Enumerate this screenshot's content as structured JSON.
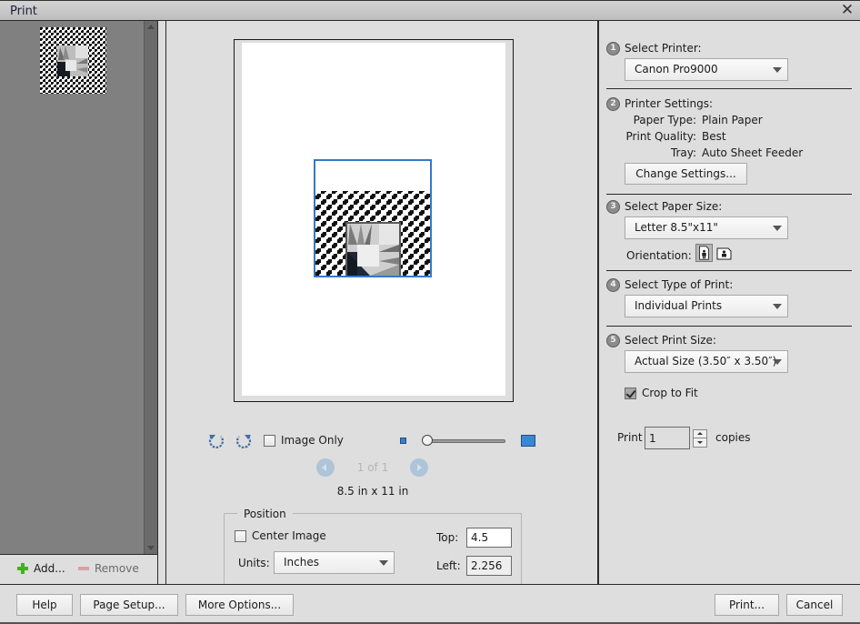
{
  "window": {
    "title": "Print",
    "close_icon": "close-icon"
  },
  "thumbnails": {
    "items": [
      {
        "name": "quilt-image-thumbnail",
        "selected": true
      }
    ],
    "add_label": "Add...",
    "remove_label": "Remove"
  },
  "preview": {
    "image_only_label": "Image Only",
    "image_only_checked": false,
    "zoom_slider_value": 0,
    "page_indicator": "1 of 1",
    "paper_size_text": "8.5 in x 11 in"
  },
  "position": {
    "legend": "Position",
    "center_image_label": "Center Image",
    "center_image_checked": false,
    "units_label": "Units:",
    "units_value": "Inches",
    "top_label": "Top:",
    "top_value": "4.5",
    "left_label": "Left:",
    "left_value": "2.256"
  },
  "steps": {
    "printer": {
      "num": "1",
      "label": "Select Printer:",
      "value": "Canon Pro9000"
    },
    "settings": {
      "num": "2",
      "label": "Printer Settings:",
      "paper_type_label": "Paper Type:",
      "paper_type": "Plain Paper",
      "quality_label": "Print Quality:",
      "quality": "Best",
      "tray_label": "Tray:",
      "tray": "Auto Sheet Feeder",
      "change_button": "Change Settings..."
    },
    "paper_size": {
      "num": "3",
      "label": "Select Paper Size:",
      "value": "Letter 8.5\"x11\"",
      "orientation_label": "Orientation:",
      "orientation": "portrait"
    },
    "print_type": {
      "num": "4",
      "label": "Select Type of Print:",
      "value": "Individual Prints"
    },
    "print_size": {
      "num": "5",
      "label": "Select Print Size:",
      "value": "Actual Size (3.50″ x 3.50″)",
      "crop_to_fit_label": "Crop to Fit",
      "crop_to_fit_checked": true
    }
  },
  "copies": {
    "prefix": "Print",
    "value": "1",
    "suffix": "copies"
  },
  "footer": {
    "help": "Help",
    "page_setup": "Page Setup...",
    "more_options": "More Options...",
    "print": "Print...",
    "cancel": "Cancel"
  },
  "colors": {
    "accent_blue": "#3677c9",
    "add_green": "#3fb21f",
    "remove_pink": "#d9a0a8"
  }
}
